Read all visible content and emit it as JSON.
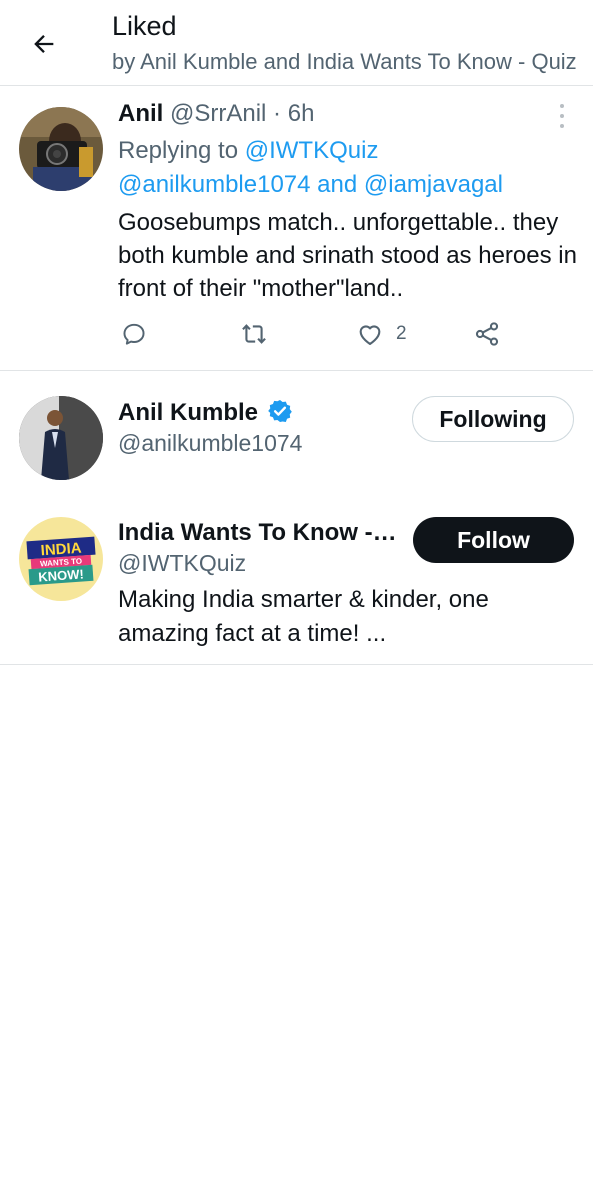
{
  "header": {
    "title": "Liked",
    "subtitle": "by Anil Kumble and India Wants To Know - Quiz"
  },
  "tweet": {
    "author_name": "Anil",
    "author_handle": "@SrrAnil",
    "separator": "·",
    "time": "6h",
    "replying_label": "Replying to",
    "reply_to_1": "@IWTKQuiz",
    "reply_to_2": "@anilkumble1074",
    "reply_joiner": "and",
    "reply_to_3": "@iamjavagal",
    "text": "Goosebumps match.. unforgettable.. they both kumble and srinath stood as heroes in front of their \"mother\"land..",
    "like_count": "2",
    "icons": [
      "reply-icon",
      "retweet-icon",
      "like-icon",
      "share-icon",
      "more-icon"
    ]
  },
  "users": [
    {
      "name": "Anil Kumble",
      "handle": "@anilkumble1074",
      "verified": true,
      "button_label": "Following"
    },
    {
      "name": "India Wants To Know - Quiz",
      "handle": "@IWTKQuiz",
      "bio": "Making India smarter & kinder, one amazing fact at a time! ...",
      "button_label": "Follow"
    }
  ],
  "colors": {
    "link": "#1d9bf0",
    "muted": "#536471",
    "text": "#0f1419",
    "border": "#e1e4e6"
  }
}
